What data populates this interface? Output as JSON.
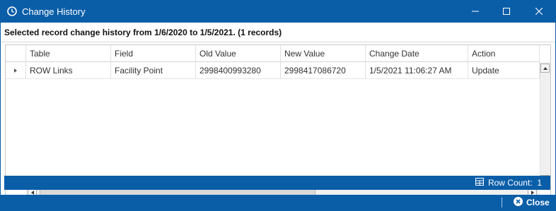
{
  "window": {
    "title": "Change History"
  },
  "icons": {
    "app": "clock-icon",
    "minimize": "minimize-icon",
    "maximize": "maximize-icon",
    "close": "close-icon",
    "row_count": "grid-icon",
    "close_button": "close-circle-icon"
  },
  "colors": {
    "chrome": "#0a5ea8",
    "text_on_chrome": "#ffffff"
  },
  "summary": "Selected record change history from 1/6/2020 to 1/5/2021. (1 records)",
  "grid": {
    "columns": [
      "Table",
      "Field",
      "Old Value",
      "New Value",
      "Change Date",
      "Action"
    ],
    "rows": [
      [
        "ROW Links",
        "Facility Point",
        "2998400993280",
        "2998417086720",
        "1/5/2021 11:06:27 AM",
        "Update"
      ]
    ]
  },
  "status": {
    "row_count": "Row Count:  1"
  },
  "footer": {
    "close_label": "Close"
  }
}
